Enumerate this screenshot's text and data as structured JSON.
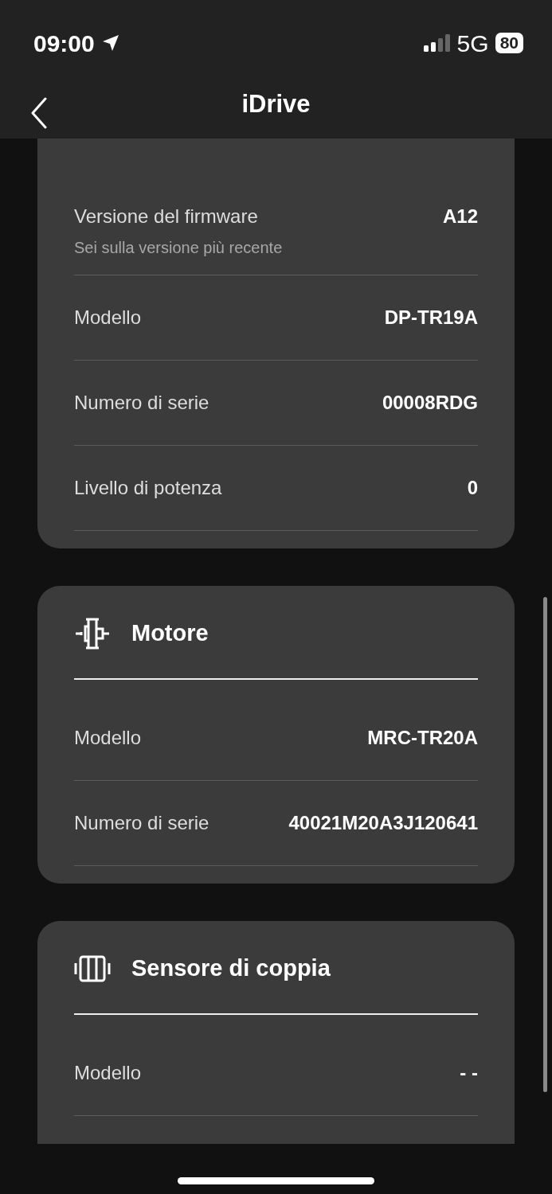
{
  "status_bar": {
    "time": "09:00",
    "network": "5G",
    "battery": "80"
  },
  "nav": {
    "title": "iDrive"
  },
  "sections": [
    {
      "rows": [
        {
          "label": "Versione del firmware",
          "subtitle": "Sei sulla versione più recente",
          "value": "A12"
        },
        {
          "label": "Modello",
          "value": "DP-TR19A"
        },
        {
          "label": "Numero di serie",
          "value": "00008RDG"
        },
        {
          "label": "Livello di potenza",
          "value": "0"
        }
      ]
    },
    {
      "title": "Motore",
      "kind": "motor",
      "rows": [
        {
          "label": "Modello",
          "value": "MRC-TR20A"
        },
        {
          "label": "Numero di serie",
          "value": "40021M20A3J120641"
        }
      ]
    },
    {
      "title": "Sensore di coppia",
      "kind": "torque-sensor",
      "rows": [
        {
          "label": "Modello",
          "value": "- -"
        }
      ]
    }
  ]
}
